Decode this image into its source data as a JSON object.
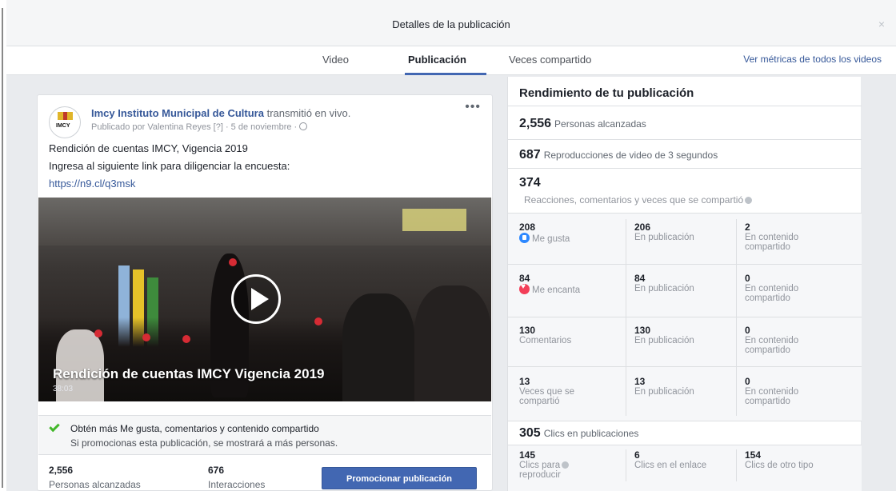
{
  "dialog": {
    "title": "Detalles de la publicación",
    "close": "×",
    "tabs": [
      "Video",
      "Publicación",
      "Veces compartido"
    ],
    "metrics_link": "Ver métricas de todos los videos"
  },
  "post": {
    "page_name": "Imcy Instituto Municipal de Cultura",
    "verb": " transmitió en vivo.",
    "meta": "Publicado por Valentina Reyes [?] · 5 de noviembre ·",
    "avatar_text": "IMCY",
    "line1": "Rendición de cuentas IMCY, Vigencia 2019",
    "line2": "Ingresa al siguiente link para diligenciar la encuesta:",
    "link": "https://n9.cl/q3msk",
    "video_title": "Rendición de cuentas IMCY Vigencia 2019",
    "video_duration": "38:03",
    "promo_heading": "Obtén más Me gusta, comentarios y contenido compartido",
    "promo_sub": "Si promocionas esta publicación, se mostrará a más personas.",
    "reach_value": "2,556",
    "reach_label": "Personas alcanzadas",
    "interactions_value": "676",
    "interactions_label": "Interacciones",
    "promote_button": "Promocionar publicación"
  },
  "panel": {
    "title": "Rendimiento de tu publicación",
    "reach_value": "2,556",
    "reach_label": "Personas alcanzadas",
    "plays3s_value": "687",
    "plays3s_label": "Reproducciones de video de 3 segundos",
    "engagement_value": "374",
    "engagement_label": "Reacciones, comentarios y veces que se compartió",
    "rows": [
      {
        "v1": "208",
        "l1": "Me gusta",
        "v2": "206",
        "l2": "En publicación",
        "v3": "2",
        "l3a": "En contenido",
        "l3b": "compartido"
      },
      {
        "v1": "84",
        "l1": "Me encanta",
        "v2": "84",
        "l2": "En publicación",
        "v3": "0",
        "l3a": "En contenido",
        "l3b": "compartido"
      },
      {
        "v1": "130",
        "l1": "Comentarios",
        "v2": "130",
        "l2": "En publicación",
        "v3": "0",
        "l3a": "En contenido",
        "l3b": "compartido"
      },
      {
        "v1": "13",
        "l1a": "Veces que se",
        "l1b": "compartió",
        "v2": "13",
        "l2": "En publicación",
        "v3": "0",
        "l3a": "En contenido",
        "l3b": "compartido"
      }
    ],
    "clicks_value": "305",
    "clicks_label": "Clics en publicaciones",
    "clicks": [
      {
        "v": "145",
        "la": "Clics para",
        "lb": "reproducir"
      },
      {
        "v": "6",
        "la": "Clics en el enlace"
      },
      {
        "v": "154",
        "la": "Clics de otro tipo"
      }
    ]
  }
}
